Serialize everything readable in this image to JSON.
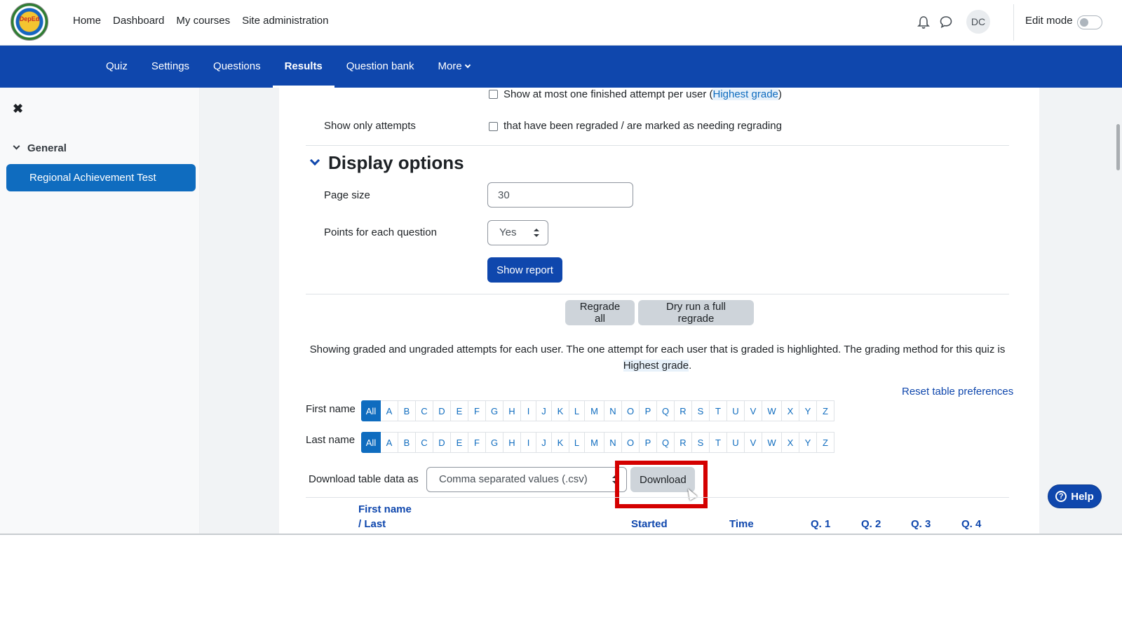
{
  "brand": {
    "logo_text": "DepEd"
  },
  "primary_nav": [
    "Home",
    "Dashboard",
    "My courses",
    "Site administration"
  ],
  "user": {
    "initials": "DC",
    "edit_mode_label": "Edit mode"
  },
  "secondary_nav": {
    "items": [
      "Quiz",
      "Settings",
      "Questions",
      "Results",
      "Question bank",
      "More"
    ],
    "active": "Results"
  },
  "drawer": {
    "close_glyph": "✖",
    "section": "General",
    "active_item": "Regional Achievement Test"
  },
  "filters": {
    "one_attempt_text_pre": "Show at most one finished attempt per user (",
    "one_attempt_link": "Highest grade",
    "one_attempt_text_post": ")",
    "only_attempts_label": "Show only attempts",
    "only_attempts_text": "that have been regraded / are marked as needing regrading"
  },
  "display_options": {
    "title": "Display options",
    "page_size_label": "Page size",
    "page_size_value": "30",
    "points_label": "Points for each question",
    "points_value": "Yes",
    "show_report": "Show report"
  },
  "regrade": {
    "regrade_all": "Regrade all",
    "dry_run": "Dry run a full regrade"
  },
  "info": {
    "text": "Showing graded and ungraded attempts for each user. The one attempt for each user that is graded is highlighted. The grading method for this quiz is",
    "link": "Highest grade",
    "end": "."
  },
  "reset_link": "Reset table preferences",
  "initials_filter": {
    "first_name_label": "First name",
    "last_name_label": "Last name",
    "letters": [
      "All",
      "A",
      "B",
      "C",
      "D",
      "E",
      "F",
      "G",
      "H",
      "I",
      "J",
      "K",
      "L",
      "M",
      "N",
      "O",
      "P",
      "Q",
      "R",
      "S",
      "T",
      "U",
      "V",
      "W",
      "X",
      "Y",
      "Z"
    ]
  },
  "download": {
    "label": "Download table data as",
    "format": "Comma separated values (.csv)",
    "button": "Download"
  },
  "table_headers": {
    "name_line1": "First name",
    "name_line2": "/ Last",
    "started": "Started",
    "time": "Time",
    "questions": [
      "Q. 1",
      "Q. 2",
      "Q. 3",
      "Q. 4"
    ]
  },
  "help": "Help"
}
